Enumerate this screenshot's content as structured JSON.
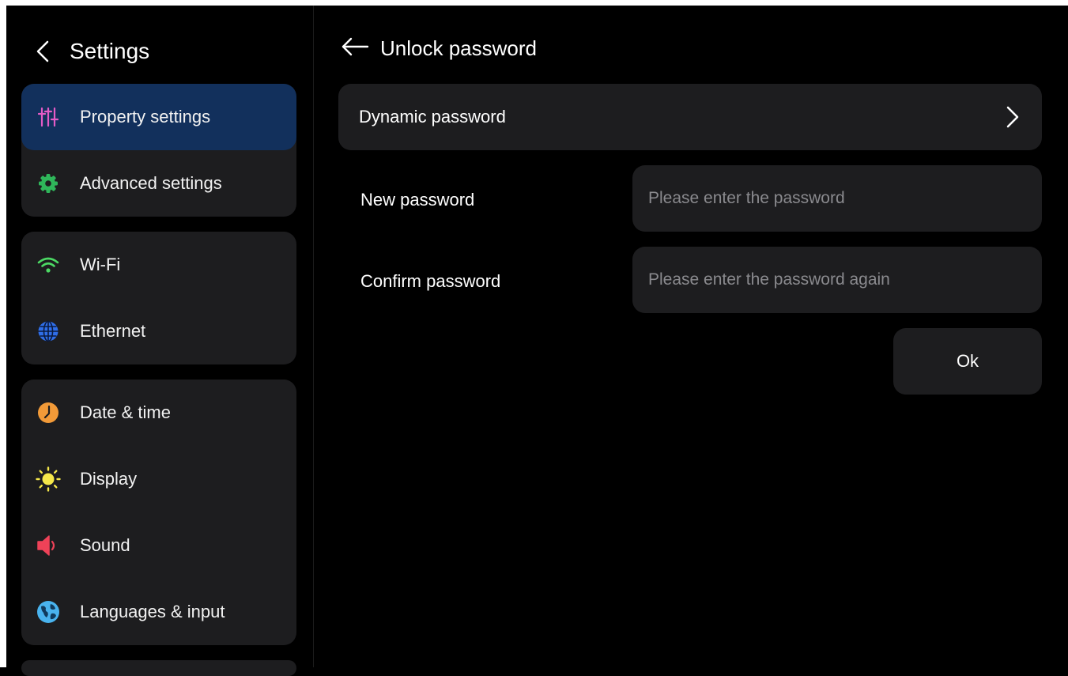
{
  "sidebar": {
    "title": "Settings",
    "groups": [
      {
        "items": [
          {
            "label": "Property settings",
            "icon": "sliders-icon",
            "active": true
          },
          {
            "label": "Advanced settings",
            "icon": "gear-icon"
          }
        ]
      },
      {
        "items": [
          {
            "label": "Wi-Fi",
            "icon": "wifi-icon"
          },
          {
            "label": "Ethernet",
            "icon": "globe-icon"
          }
        ]
      },
      {
        "items": [
          {
            "label": "Date & time",
            "icon": "clock-icon"
          },
          {
            "label": "Display",
            "icon": "sun-icon"
          },
          {
            "label": "Sound",
            "icon": "speaker-icon"
          },
          {
            "label": "Languages & input",
            "icon": "earth-icon"
          }
        ]
      }
    ]
  },
  "main": {
    "title": "Unlock password",
    "dynamic_password": "Dynamic password",
    "new_password": {
      "label": "New password",
      "placeholder": "Please enter the password",
      "value": ""
    },
    "confirm_password": {
      "label": "Confirm password",
      "placeholder": "Please enter the password again",
      "value": ""
    },
    "ok_label": "Ok"
  },
  "colors": {
    "background": "#000000",
    "card": "#1d1d1f",
    "active_item": "#12305c",
    "sliders_icon": "#e35bc6",
    "gear_icon": "#2fb65a",
    "wifi_icon": "#4cd964",
    "globe_icon": "#2f6ee8",
    "clock_icon": "#f29a38",
    "sun_icon": "#f5e84a",
    "speaker_icon": "#ee4258",
    "earth_icon": "#49b3ee"
  }
}
